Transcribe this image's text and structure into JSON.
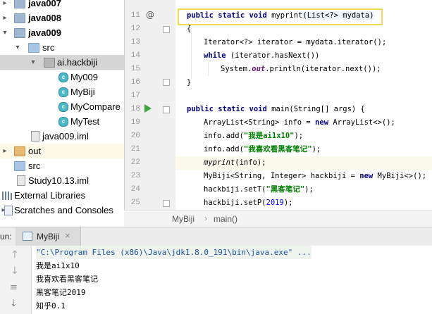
{
  "project_tree": {
    "items": [
      {
        "label": "java007",
        "type": "module",
        "expanded": false
      },
      {
        "label": "java008",
        "type": "module",
        "expanded": false
      },
      {
        "label": "java009",
        "type": "module",
        "expanded": true
      },
      {
        "label": "src",
        "type": "folder",
        "expanded": true
      },
      {
        "label": "ai.hackbiji",
        "type": "package",
        "expanded": true
      },
      {
        "label": "My009",
        "type": "class"
      },
      {
        "label": "MyBiji",
        "type": "class"
      },
      {
        "label": "MyCompare",
        "type": "class"
      },
      {
        "label": "MyTest",
        "type": "class"
      },
      {
        "label": "java009.iml",
        "type": "iml"
      },
      {
        "label": "out",
        "type": "folder-orange",
        "expanded": false
      },
      {
        "label": "src",
        "type": "folder"
      },
      {
        "label": "Study10.13.iml",
        "type": "iml"
      },
      {
        "label": "External Libraries",
        "type": "libraries"
      },
      {
        "label": "Scratches and Consoles",
        "type": "scratches"
      }
    ]
  },
  "editor": {
    "line_numbers": [
      "11",
      "12",
      "13",
      "14",
      "15",
      "16",
      "17",
      "18",
      "19",
      "20",
      "21",
      "22",
      "23",
      "24",
      "25"
    ],
    "lines": {
      "l11": {
        "kw1": "public static void",
        "name": " myprint",
        "params": "(List<?> mydata)"
      },
      "l12": {
        "text": "{"
      },
      "l13": {
        "text": "Iterator<?> iterator = mydata.iterator();"
      },
      "l14": {
        "kw": "while",
        "rest": " (iterator.hasNext())"
      },
      "l15": {
        "pre": "System.",
        "out": "out",
        "post": ".println(iterator.next());"
      },
      "l16": {
        "text": "}"
      },
      "l18": {
        "kw": "public static void",
        "rest": " main(String[] args) {"
      },
      "l19": {
        "pre": "ArrayList<String> info = ",
        "kw": "new",
        "post": " ArrayList<>();"
      },
      "l20": {
        "pre": "info.add(",
        "str": "\"我是ai1x10\"",
        "post": ");"
      },
      "l21": {
        "pre": "info.add(",
        "str": "\"我喜欢看黑客笔记\"",
        "post": ");"
      },
      "l22": {
        "call": "myprint",
        "post": "(info);"
      },
      "l23": {
        "pre": "MyBiji<String, Integer> hackbiji = ",
        "kw": "new",
        "post": " MyBiji<>();"
      },
      "l24": {
        "pre": "hackbiji.setT(",
        "str": "\"黑客笔记\"",
        "post": ");"
      },
      "l25": {
        "pre": "hackbiji.setP(",
        "num": "2019",
        "post": ");"
      }
    }
  },
  "breadcrumb": {
    "items": [
      "MyBiji",
      "main()"
    ]
  },
  "run_panel": {
    "label": "un:",
    "tab": "MyBiji",
    "console": [
      "\"C:\\Program Files (x86)\\Java\\jdk1.8.0_191\\bin\\java.exe\" ...",
      "我是ai1x10",
      "我喜欢看黑客笔记",
      "黑客笔记2019",
      "知乎0.1"
    ]
  },
  "colors": {
    "keyword": "#000080",
    "string": "#008000",
    "highlight_box": "#f2d94f",
    "selection": "#d5d5d5"
  }
}
